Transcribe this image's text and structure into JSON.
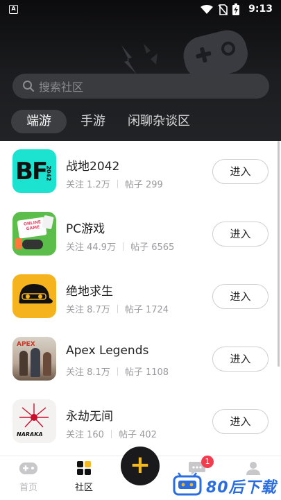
{
  "status_bar": {
    "app_icon": "A",
    "time": "9:13"
  },
  "search": {
    "placeholder": "搜索社区"
  },
  "tabs": [
    {
      "label": "端游",
      "active": true
    },
    {
      "label": "手游",
      "active": false
    },
    {
      "label": "闲聊杂谈区",
      "active": false
    }
  ],
  "communities": [
    {
      "name": "战地2042",
      "followers_label": "关注 1.2万",
      "posts_label": "帖子 299",
      "button": "进入",
      "logo_text": "BF",
      "logo_sub": "2042"
    },
    {
      "name": "PC游戏",
      "followers_label": "关注 44.9万",
      "posts_label": "帖子 6565",
      "button": "进入",
      "logo_text": "ONLINE GAME"
    },
    {
      "name": "绝地求生",
      "followers_label": "关注 8.7万",
      "posts_label": "帖子 1724",
      "button": "进入"
    },
    {
      "name": "Apex Legends",
      "followers_label": "关注 8.1万",
      "posts_label": "帖子 1108",
      "button": "进入",
      "logo_text": "APEX"
    },
    {
      "name": "永劫无间",
      "followers_label": "关注 160",
      "posts_label": "帖子 402",
      "button": "进入",
      "logo_text": "NARAKA"
    }
  ],
  "bottom_nav": {
    "home": "首页",
    "community": "社区",
    "messages_badge": "1",
    "fab": "+"
  },
  "watermark": {
    "text": "80后下载"
  },
  "colors": {
    "accent": "#f5b91d",
    "badge": "#f23d4f",
    "watermark": "#2a6de0"
  }
}
